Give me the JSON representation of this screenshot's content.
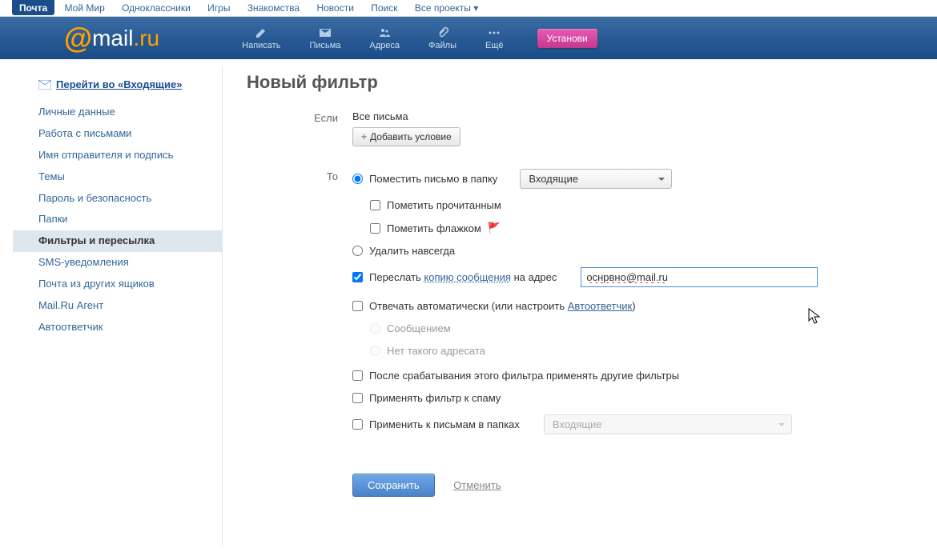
{
  "portal_nav": [
    "Почта",
    "Мой Мир",
    "Одноклассники",
    "Игры",
    "Знакомства",
    "Новости",
    "Поиск",
    "Все проекты ▾"
  ],
  "logo": {
    "mail": "mail",
    "ru": ".ru"
  },
  "toolbar": [
    {
      "label": "Написать",
      "icon": "pencil"
    },
    {
      "label": "Письма",
      "icon": "envelope"
    },
    {
      "label": "Адреса",
      "icon": "contacts"
    },
    {
      "label": "Файлы",
      "icon": "clip"
    },
    {
      "label": "Ещё",
      "icon": "dots"
    }
  ],
  "install_btn": "Установи",
  "inbox_link": "Перейти во «Входящие»",
  "sidebar": [
    {
      "label": "Личные данные"
    },
    {
      "label": "Работа с письмами"
    },
    {
      "label": "Имя отправителя и подпись"
    },
    {
      "label": "Темы"
    },
    {
      "label": "Пароль и безопасность"
    },
    {
      "label": "Папки"
    },
    {
      "label": "Фильтры и пересылка",
      "active": true
    },
    {
      "label": "SMS-уведомления"
    },
    {
      "label": "Почта из других ящиков"
    },
    {
      "label": "Mail.Ru Агент"
    },
    {
      "label": "Автоответчик"
    }
  ],
  "page_title": "Новый фильтр",
  "labels": {
    "if": "Если",
    "then": "То"
  },
  "if_block": {
    "all_messages": "Все письма",
    "add_condition": "Добавить условие"
  },
  "then": {
    "move_to_folder": "Поместить письмо в папку",
    "folder_value": "Входящие",
    "mark_read": "Пометить прочитанным",
    "mark_flag": "Пометить флажком",
    "delete_forever": "Удалить навсегда",
    "forward_prefix": "Переслать ",
    "forward_link": "копию сообщения",
    "forward_suffix": " на адрес",
    "forward_email": "оснрвно@mail.ru",
    "autoreply_prefix": "Отвечать автоматически (или настроить ",
    "autoreply_link": "Автоответчик",
    "autoreply_suffix": ")",
    "reply_message": "Сообщением",
    "reply_noaddr": "Нет такого адресата",
    "after_filter": "После срабатывания этого фильтра применять другие фильтры",
    "apply_spam": "Применять фильтр к спаму",
    "apply_folders": "Применить к письмам в папках",
    "apply_folders_value": "Входящие"
  },
  "actions": {
    "save": "Сохранить",
    "cancel": "Отменить"
  }
}
